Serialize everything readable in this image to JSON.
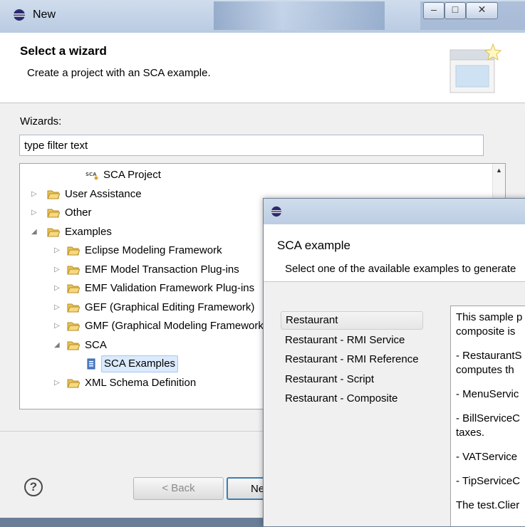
{
  "window": {
    "title": "New",
    "controls": {
      "minimize": "–",
      "maximize": "□",
      "close": "✕"
    }
  },
  "header": {
    "title": "Select a wizard",
    "description": "Create a project with an SCA example."
  },
  "wizards_label": "Wizards:",
  "filter": {
    "value": "type filter text"
  },
  "tree": [
    {
      "label": "SCA Project",
      "depth": 2,
      "arrow": "",
      "icon": "sca-project-icon"
    },
    {
      "label": "User Assistance",
      "depth": 0,
      "arrow": "▷",
      "icon": "folder-icon"
    },
    {
      "label": "Other",
      "depth": 0,
      "arrow": "▷",
      "icon": "folder-icon"
    },
    {
      "label": "Examples",
      "depth": 0,
      "arrow": "◢",
      "icon": "folder-icon"
    },
    {
      "label": "Eclipse Modeling Framework",
      "depth": 1,
      "arrow": "▷",
      "icon": "folder-icon"
    },
    {
      "label": "EMF Model Transaction Plug-ins",
      "depth": 1,
      "arrow": "▷",
      "icon": "folder-icon"
    },
    {
      "label": "EMF Validation Framework Plug-ins",
      "depth": 1,
      "arrow": "▷",
      "icon": "folder-icon"
    },
    {
      "label": "GEF (Graphical Editing Framework)",
      "depth": 1,
      "arrow": "▷",
      "icon": "folder-icon"
    },
    {
      "label": "GMF (Graphical Modeling Framework)",
      "depth": 1,
      "arrow": "▷",
      "icon": "folder-icon"
    },
    {
      "label": "SCA",
      "depth": 1,
      "arrow": "◢",
      "icon": "folder-icon"
    },
    {
      "label": "SCA Examples",
      "depth": 2,
      "arrow": "",
      "icon": "sca-examples-icon",
      "selected": true
    },
    {
      "label": "XML Schema Definition",
      "depth": 1,
      "arrow": "▷",
      "icon": "folder-icon"
    }
  ],
  "buttons": {
    "help": "?",
    "back": "< Back",
    "next": "Next >"
  },
  "sca_dialog": {
    "title": "SCA example",
    "description": "Select one of the available examples to generate",
    "examples": [
      {
        "label": "Restaurant",
        "selected": true
      },
      {
        "label": "Restaurant - RMI Service"
      },
      {
        "label": "Restaurant - RMI Reference"
      },
      {
        "label": "Restaurant - Script"
      },
      {
        "label": "Restaurant - Composite"
      }
    ],
    "details": [
      "This sample p",
      "composite is",
      "",
      "- RestaurantS",
      "computes th",
      "",
      "- MenuServic",
      "",
      "- BillServiceC",
      "taxes.",
      "",
      "- VATService",
      "",
      "- TipServiceC",
      "",
      "The test.Clier"
    ]
  },
  "colors": {
    "selection": "#dbeafc",
    "titlebar": "#bccde3",
    "folder": "#e8c35c"
  }
}
